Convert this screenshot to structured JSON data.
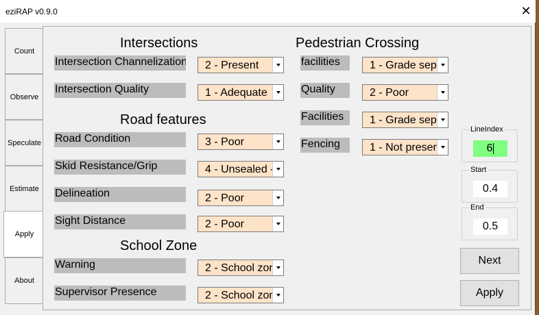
{
  "window": {
    "title": "eziRAP v0.9.0",
    "close_glyph": "✕"
  },
  "tabs": [
    {
      "label": "Count"
    },
    {
      "label": "Observe"
    },
    {
      "label": "Speculate"
    },
    {
      "label": "Estimate"
    },
    {
      "label": "Apply",
      "active": true
    },
    {
      "label": "About"
    }
  ],
  "intersections": {
    "heading": "Intersections",
    "channelization_label": "Intersection Channelization",
    "channelization_value": "2 - Present",
    "quality_label": "Intersection Quality",
    "quality_value": "1 - Adequate"
  },
  "road_features": {
    "heading": "Road features",
    "condition_label": "Road Condition",
    "condition_value": "3 - Poor",
    "skid_label": "Skid Resistance/Grip",
    "skid_value": "4 - Unsealed -",
    "delineation_label": "Delineation",
    "delineation_value": "2 - Poor",
    "sight_label": "Sight Distance",
    "sight_value": "2 - Poor"
  },
  "school_zone": {
    "heading": "School Zone",
    "warning_label": "Warning",
    "warning_value": "2 - School zon",
    "supervisor_label": "Supervisor Presence",
    "supervisor_value": "2 - School zon"
  },
  "pedestrian": {
    "heading": "Pedestrian Crossing",
    "facilities_label": "facilities",
    "facilities_value": "1 - Grade sep",
    "quality_label": "Quality",
    "quality_value": "2 - Poor",
    "facilities2_label": "Facilities",
    "facilities2_value": "1 - Grade sep",
    "fencing_label": "Fencing",
    "fencing_value": "1 - Not preser"
  },
  "line_index": {
    "label": "LineIndex",
    "value": "6"
  },
  "start": {
    "label": "Start",
    "value": "0.4"
  },
  "end": {
    "label": "End",
    "value": "0.5"
  },
  "buttons": {
    "next": "Next",
    "apply": "Apply"
  },
  "colors": {
    "combo_bg": "#fde3c8",
    "label_bg": "#bcbcbc",
    "line_index_bg": "#80ff80",
    "backdrop": "#8a5a2b"
  }
}
